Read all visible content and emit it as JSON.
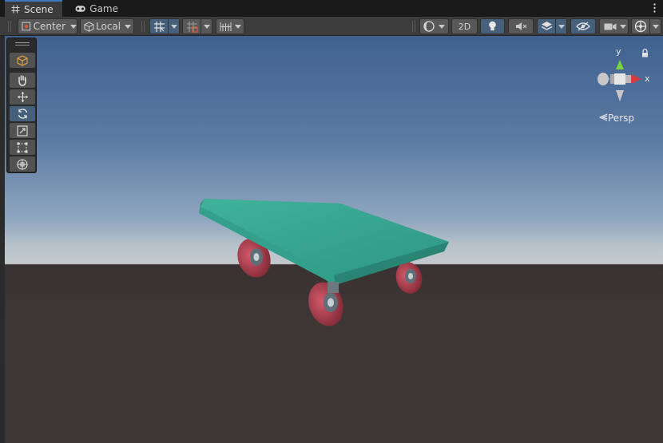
{
  "tabs": [
    {
      "label": "Scene",
      "icon": "hash-icon",
      "active": true
    },
    {
      "label": "Game",
      "icon": "gamepad-icon",
      "active": false
    }
  ],
  "toolbar": {
    "pivot_label": "Center",
    "space_label": "Local",
    "mode_2d_label": "2D"
  },
  "gizmo": {
    "y_label": "y",
    "x_label": "x",
    "projection_label": "Persp"
  },
  "colors": {
    "accent": "#46607c",
    "sky_top": "#40628f",
    "horizon": "#c4c8cb",
    "ground": "#3e3634",
    "board": "#3aa48f",
    "wheel": "#b03a4b",
    "axis_x": "#d93b3b",
    "axis_y": "#7ad43b"
  }
}
